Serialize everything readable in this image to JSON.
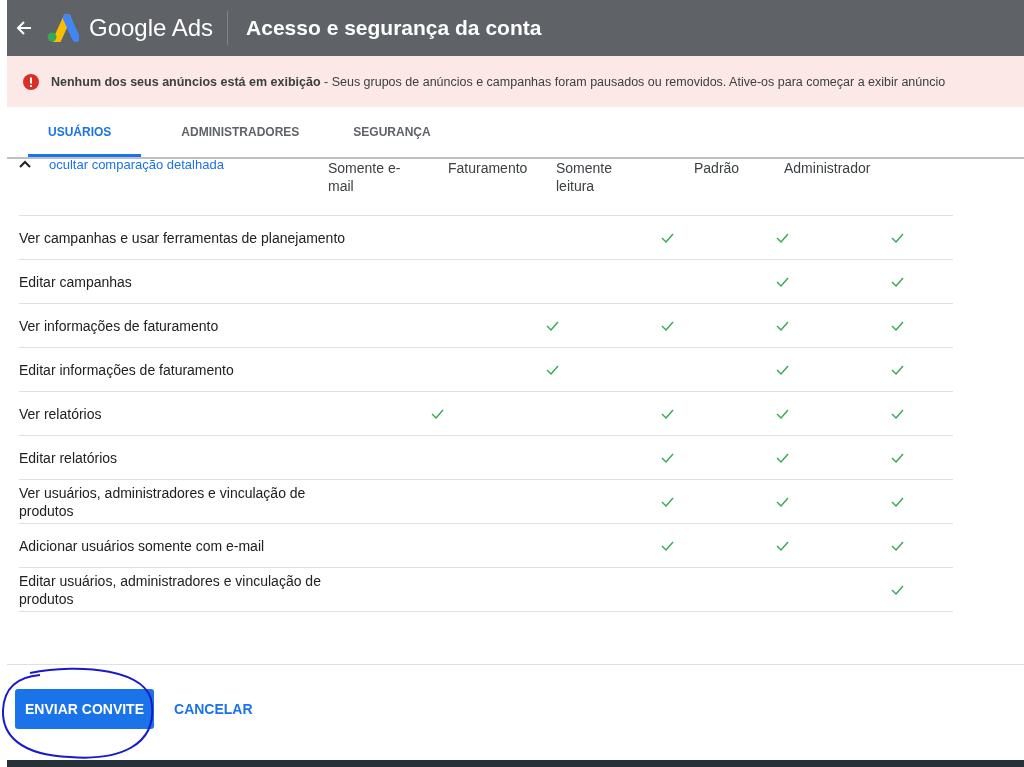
{
  "header": {
    "product": "Google Ads",
    "title": "Acesso e segurança da conta"
  },
  "alert": {
    "text": "**Nenhum dos seus anúncios está em exibição** - Seus grupos de anúncios e campanhas foram pausados ou removidos. Ative-os para começar a exibir anúncio"
  },
  "tabs": [
    {
      "label": "USUÁRIOS",
      "selected": true
    },
    {
      "label": "ADMINISTRADORES",
      "selected": false
    },
    {
      "label": "SEGURANÇA",
      "selected": false
    }
  ],
  "table": {
    "toggle": "ocultar comparação detalhada",
    "columns": [
      "Somente e-mail",
      "Faturamento",
      "Somente leitura",
      "Padrão",
      "Administrador"
    ],
    "rows": [
      {
        "label": "Ver campanhas e usar ferramentas de planejamento",
        "checked": [
          false,
          false,
          true,
          true,
          true
        ]
      },
      {
        "label": "Editar campanhas",
        "checked": [
          false,
          false,
          false,
          true,
          true
        ]
      },
      {
        "label": "Ver informações de faturamento",
        "checked": [
          false,
          true,
          true,
          true,
          true
        ]
      },
      {
        "label": "Editar informações de faturamento",
        "checked": [
          false,
          true,
          false,
          true,
          true
        ]
      },
      {
        "label": "Ver relatórios",
        "checked": [
          true,
          false,
          true,
          true,
          true
        ]
      },
      {
        "label": "Editar relatórios",
        "checked": [
          false,
          false,
          true,
          true,
          true
        ]
      },
      {
        "label": "Ver usuários, administradores e vinculação de produtos",
        "checked": [
          false,
          false,
          true,
          true,
          true
        ]
      },
      {
        "label": "Adicionar usuários somente com e-mail",
        "checked": [
          false,
          false,
          true,
          true,
          true
        ]
      },
      {
        "label": "Editar usuários, administradores e vinculação de produtos",
        "checked": [
          false,
          false,
          false,
          false,
          true
        ]
      }
    ]
  },
  "buttons": {
    "primary": "ENVIAR CONVITE",
    "secondary": "CANCELAR"
  }
}
